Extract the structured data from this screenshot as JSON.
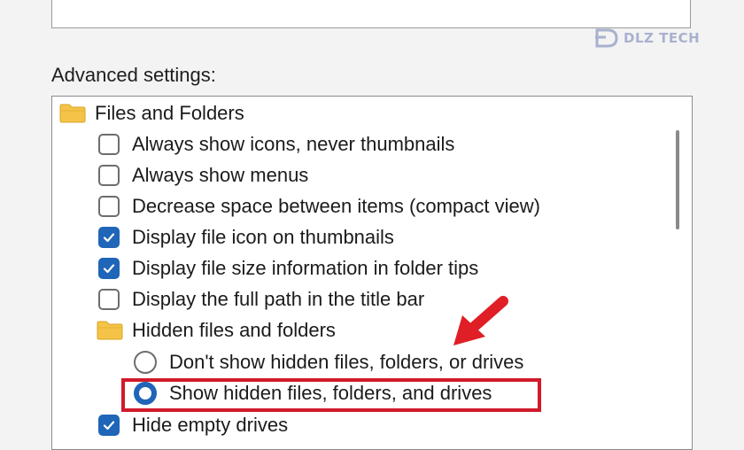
{
  "advanced_label": "Advanced settings:",
  "watermark_text": "DLZ TECH",
  "colors": {
    "accent": "#1f65b8",
    "highlight": "#d11a2a",
    "folder": "#f4c348"
  },
  "tree": {
    "group_files": "Files and Folders",
    "items": [
      {
        "label": "Always show icons, never thumbnails",
        "checked": false
      },
      {
        "label": "Always show menus",
        "checked": false
      },
      {
        "label": "Decrease space between items (compact view)",
        "checked": false
      },
      {
        "label": "Display file icon on thumbnails",
        "checked": true
      },
      {
        "label": "Display file size information in folder tips",
        "checked": true
      },
      {
        "label": "Display the full path in the title bar",
        "checked": false
      }
    ],
    "group_hidden": "Hidden files and folders",
    "radios": [
      {
        "label": "Don't show hidden files, folders, or drives",
        "selected": false
      },
      {
        "label": "Show hidden files, folders, and drives",
        "selected": true
      }
    ],
    "after_items": [
      {
        "label": "Hide empty drives",
        "checked": true
      }
    ]
  },
  "icons": {
    "folder": "folder-icon",
    "check": "checkmark-icon",
    "arrow": "red-arrow-icon"
  }
}
